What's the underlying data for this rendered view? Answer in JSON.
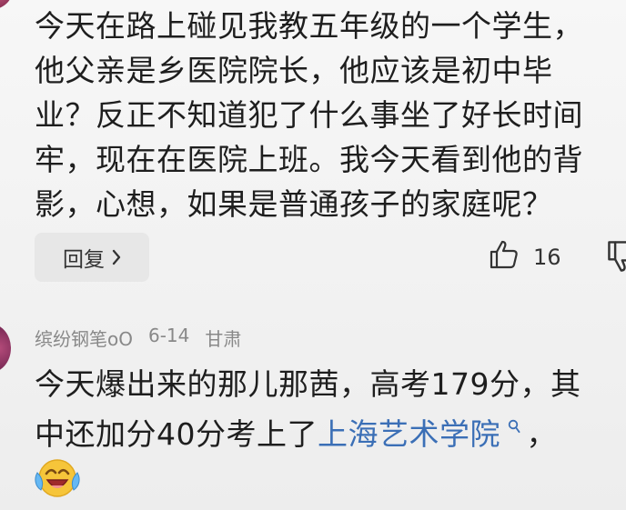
{
  "comment1": {
    "lines": [
      "今天在路上碰见我教五年级的一个学生，",
      "他父亲是乡医院院长，他应该是初中毕",
      "业？反正不知道犯了什么事坐了好长时间",
      "牢，现在在医院上班。我今天看到他的背",
      "影，心想，如果是普通孩子的家庭呢？"
    ],
    "reply_label": "回复",
    "like_count": "16",
    "icons": [
      "chevron-right-icon",
      "thumbs-up-icon",
      "thumbs-down-icon"
    ]
  },
  "comment2": {
    "username": "缤纷钢笔oO",
    "date": "6-14",
    "location": "甘肃",
    "line1": "今天爆出来的那儿那茜，高考179分，其",
    "line2_prefix": "中还加分40分考上了",
    "link_text": "上海艺术学院",
    "line2_suffix": "，",
    "icons": [
      "search-icon",
      "laughing-crying-emoji-icon"
    ]
  },
  "colors": {
    "text": "#1e1e1e",
    "meta": "#888888",
    "link": "#3b6fb6",
    "button_bg": "#e7e7e7"
  }
}
